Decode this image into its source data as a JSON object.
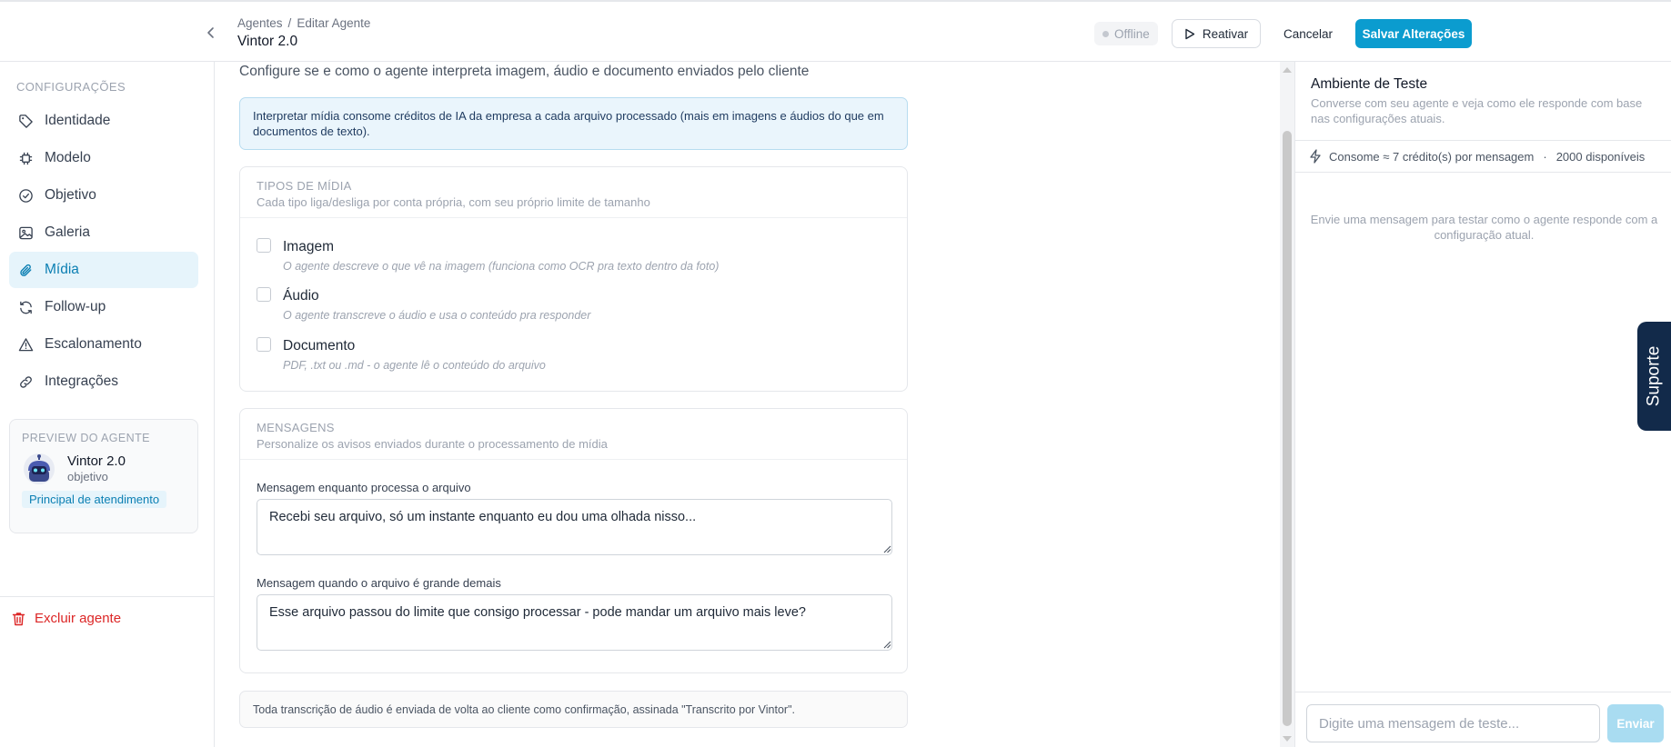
{
  "header": {
    "breadcrumb": [
      "Agentes",
      "Editar Agente"
    ],
    "breadcrumb_sep": "/",
    "title": "Vintor 2.0",
    "status": "Offline",
    "reactivate_label": "Reativar",
    "cancel_label": "Cancelar",
    "save_label": "Salvar Alterações"
  },
  "sidebar": {
    "heading": "CONFIGURAÇÕES",
    "items": [
      {
        "label": "Identidade",
        "icon": "tag-icon"
      },
      {
        "label": "Modelo",
        "icon": "chip-icon"
      },
      {
        "label": "Objetivo",
        "icon": "check-circle-icon"
      },
      {
        "label": "Galeria",
        "icon": "image-icon"
      },
      {
        "label": "Mídia",
        "icon": "paperclip-icon",
        "active": true
      },
      {
        "label": "Follow-up",
        "icon": "refresh-icon"
      },
      {
        "label": "Escalonamento",
        "icon": "warning-icon"
      },
      {
        "label": "Integrações",
        "icon": "link-icon"
      }
    ],
    "preview": {
      "heading": "PREVIEW DO AGENTE",
      "name": "Vintor 2.0",
      "subtitle": "objetivo",
      "tag": "Principal de atendimento"
    },
    "delete_label": "Excluir agente"
  },
  "main": {
    "intro": "Configure se e como o agente interpreta imagem, áudio e documento enviados pelo cliente",
    "info": "Interpretar mídia consome créditos de IA da empresa a cada arquivo processado (mais em imagens e áudios do que em documentos de texto).",
    "media_types": {
      "title": "TIPOS DE MÍDIA",
      "description": "Cada tipo liga/desliga por conta própria, com seu próprio limite de tamanho",
      "items": [
        {
          "label": "Imagem",
          "description": "O agente descreve o que vê na imagem (funciona como OCR pra texto dentro da foto)",
          "checked": false
        },
        {
          "label": "Áudio",
          "description": "O agente transcreve o áudio e usa o conteúdo pra responder",
          "checked": false
        },
        {
          "label": "Documento",
          "description": "PDF, .txt ou .md - o agente lê o conteúdo do arquivo",
          "checked": false
        }
      ]
    },
    "messages": {
      "title": "MENSAGENS",
      "description": "Personalize os avisos enviados durante o processamento de mídia",
      "processing_label": "Mensagem enquanto processa o arquivo",
      "processing_value": "Recebi seu arquivo, só um instante enquanto eu dou uma olhada nisso...",
      "too_large_label": "Mensagem quando o arquivo é grande demais",
      "too_large_value": "Esse arquivo passou do limite que consigo processar - pode mandar um arquivo mais leve?"
    },
    "footer_note": "Toda transcrição de áudio é enviada de volta ao cliente como confirmação, assinada \"Transcrito por Vintor\"."
  },
  "test_panel": {
    "title": "Ambiente de Teste",
    "description": "Converse com seu agente e veja como ele responde com base nas configurações atuais.",
    "credits": "Consome ≈ 7 crédito(s) por mensagem",
    "credits_sep": "·",
    "available": "2000 disponíveis",
    "empty": "Envie uma mensagem para testar como o agente responde com a configuração atual.",
    "input_placeholder": "Digite uma mensagem de teste...",
    "send_label": "Enviar"
  },
  "support_label": "Suporte",
  "colors": {
    "accent": "#0b9ccf",
    "active_bg": "#e6f4fb",
    "danger": "#dc2626",
    "support_bg": "#122a4a"
  }
}
